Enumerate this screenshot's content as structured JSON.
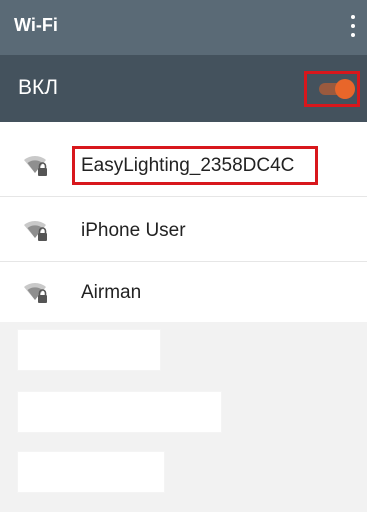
{
  "appbar": {
    "title": "Wi-Fi",
    "menu_icon": "more-vert-icon"
  },
  "master_switch": {
    "label": "ВКЛ",
    "state": "on",
    "accent": "#e8662a"
  },
  "networks": [
    {
      "ssid": "EasyLighting_2358DC4C",
      "icon": "wifi-locked-icon",
      "highlighted": true
    },
    {
      "ssid": "iPhone User",
      "icon": "wifi-locked-icon"
    },
    {
      "ssid": "Airman",
      "icon": "wifi-locked-icon"
    }
  ],
  "colors": {
    "appbar": "#5a6a76",
    "switchbar": "#44525d",
    "highlight": "#d8171c"
  }
}
